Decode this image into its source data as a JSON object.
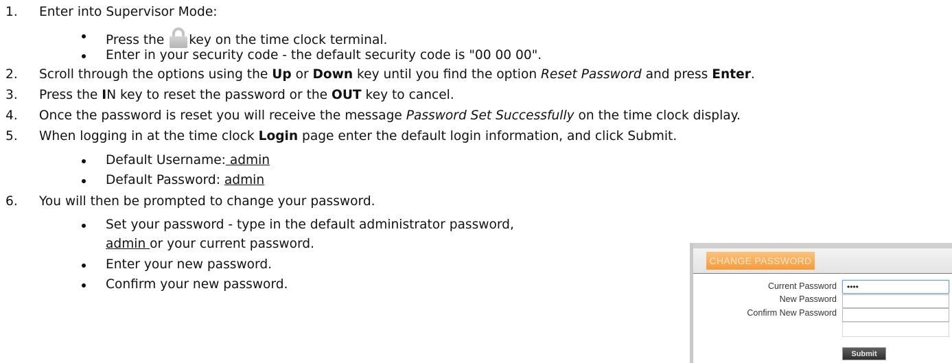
{
  "steps": [
    {
      "number": "1.",
      "text": "Enter into Supervisor Mode:",
      "bullets": [
        {
          "before": "Press the",
          "icon": "lock-icon",
          "after": "key on the time clock terminal."
        },
        {
          "text": "Enter in your security code - the default security code is \"00 00 00\"."
        }
      ]
    },
    {
      "number": "2.",
      "parts": [
        "Scroll through the options using the ",
        "Up",
        " or ",
        "Down",
        " key until you find the option ",
        "Reset Password",
        " and press ",
        "Enter",
        "."
      ]
    },
    {
      "number": "3.",
      "parts": [
        "Press the ",
        "I",
        "N key to reset the password or the ",
        "OUT",
        " key to cancel."
      ]
    },
    {
      "number": "4.",
      "parts": [
        " Once the password is reset you will receive the message ",
        "Password Set Successfully",
        " on the time clock display."
      ]
    },
    {
      "number": "5.",
      "parts": [
        "When logging in at the time clock ",
        "Login",
        " page enter the default login information, and click Submit."
      ],
      "bullets": [
        {
          "label": "Default Username:",
          "value": " admin"
        },
        {
          "label": "Default Password: ",
          "value": "admin"
        }
      ]
    },
    {
      "number": "6.",
      "text": "You will then be prompted to change your password.",
      "bullets": [
        {
          "line1": "Set your password - type in the default administrator password,",
          "line2_link": "admin ",
          "line2_rest": "or your current password."
        },
        {
          "text": "Enter your new password."
        },
        {
          "text": "Confirm your new password."
        }
      ]
    }
  ],
  "change_password_widget": {
    "title": "CHANGE PASSWORD",
    "fields": [
      {
        "label": "Current Password",
        "value": "••••"
      },
      {
        "label": "New Password",
        "value": ""
      },
      {
        "label": "Confirm New Password",
        "value": ""
      }
    ],
    "submit_label": "Submit",
    "accent_color": "#f79a3a"
  }
}
